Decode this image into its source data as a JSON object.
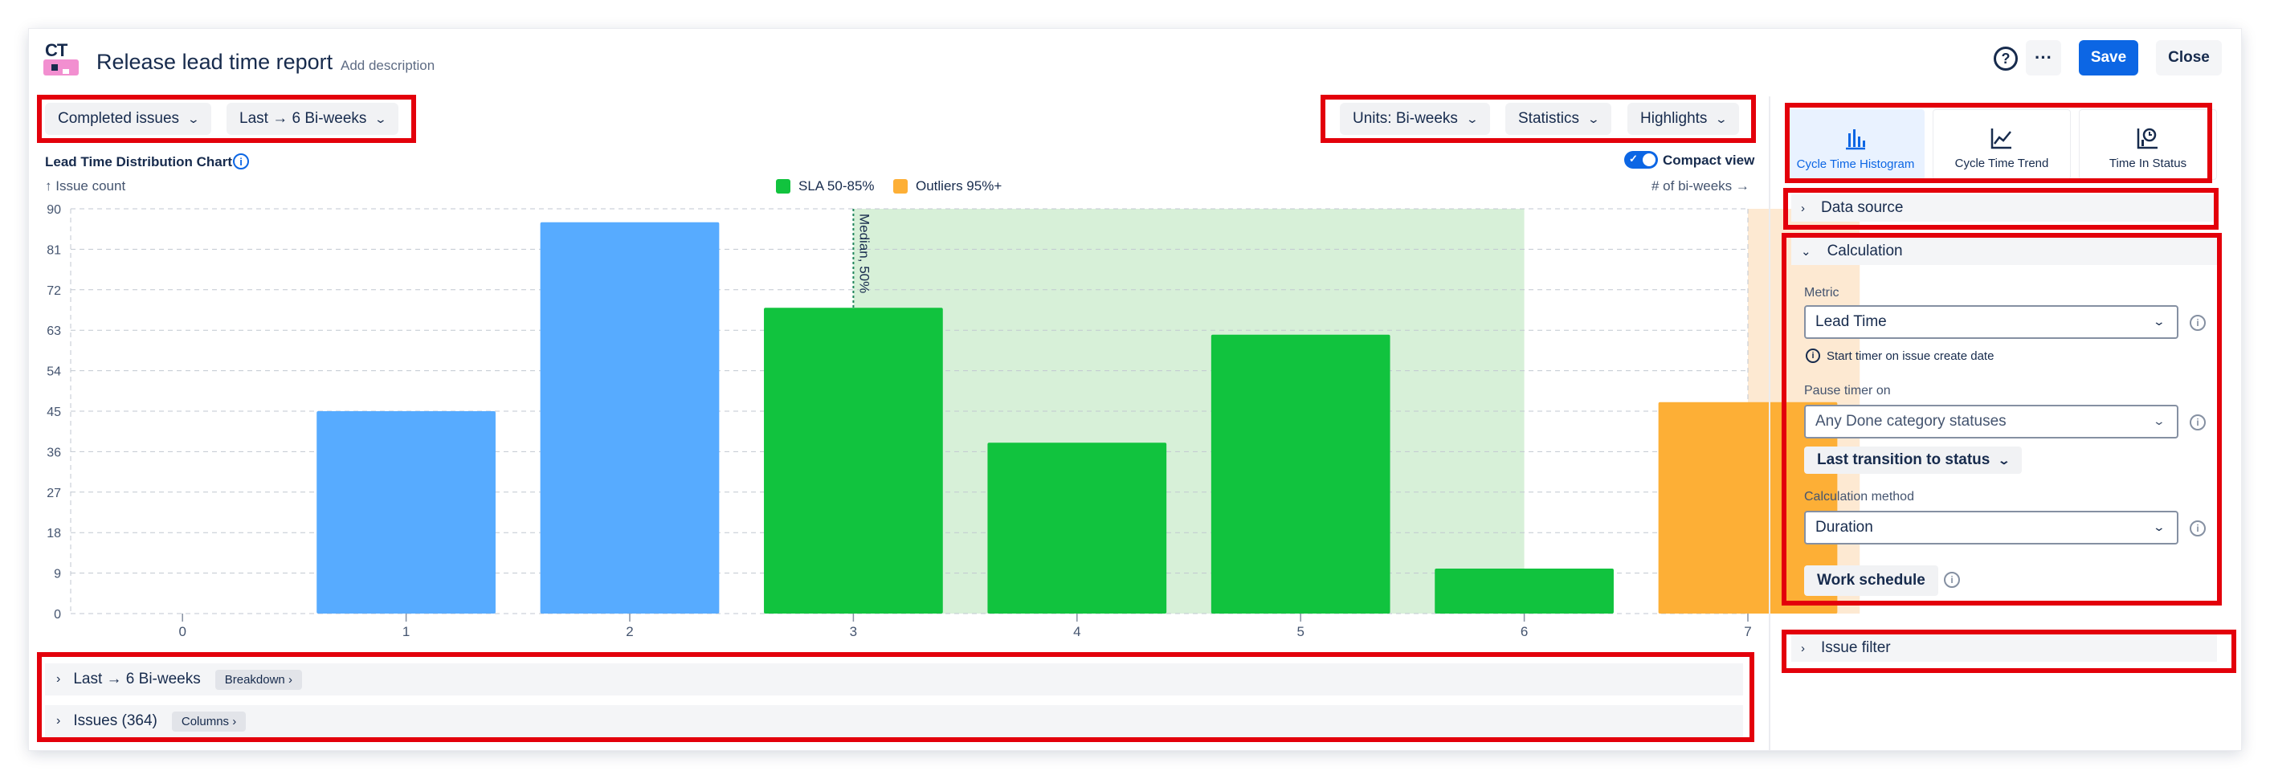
{
  "header": {
    "title": "Release lead time report",
    "add_description": "Add description",
    "help_label": "?",
    "more_label": "···",
    "save_label": "Save",
    "close_label": "Close",
    "logo_text": "CT"
  },
  "toolbar": {
    "issues_filter": "Completed issues",
    "period": "Last → 6 Bi-weeks",
    "units": "Units: Bi-weeks",
    "statistics": "Statistics",
    "highlights": "Highlights"
  },
  "chart_header": {
    "title": "Lead Time Distribution Chart",
    "compact_view": "Compact view",
    "y_hint": "↑ Issue count",
    "x_hint": "# of bi-weeks →"
  },
  "chart_data": {
    "type": "bar",
    "title": "Lead Time Distribution Chart",
    "xlabel": "# of bi-weeks",
    "ylabel": "Issue count",
    "categories": [
      "0",
      "1",
      "2",
      "3",
      "4",
      "5",
      "6",
      "7"
    ],
    "values": [
      0,
      45,
      87,
      68,
      38,
      62,
      10,
      47
    ],
    "bar_colors": [
      "#57abff",
      "#57abff",
      "#57abff",
      "#11c33e",
      "#11c33e",
      "#11c33e",
      "#11c33e",
      "#fdaf36"
    ],
    "ylim": [
      0,
      90
    ],
    "yticks": [
      0,
      9,
      18,
      27,
      36,
      45,
      54,
      63,
      72,
      81,
      90
    ],
    "grid": true,
    "legend": [
      {
        "name": "SLA 50-85%",
        "color": "#11c33e"
      },
      {
        "name": "Outliers 95%+",
        "color": "#fdaf36"
      }
    ],
    "bands": [
      {
        "name": "SLA 50-85%",
        "from": 3,
        "to": 6,
        "color": "#d7f0d8"
      },
      {
        "name": "Outliers 95%+",
        "from": 7,
        "to": 7.5,
        "color": "#fde9d2"
      }
    ],
    "median": {
      "label": "Median, 50%",
      "x": 3
    }
  },
  "accordion": {
    "period_label": "Last → 6 Bi-weeks",
    "breakdown": "Breakdown",
    "issues_label": "Issues (364)",
    "columns": "Columns"
  },
  "panel": {
    "tabs": [
      {
        "label": "Cycle Time Histogram"
      },
      {
        "label": "Cycle Time Trend"
      },
      {
        "label": "Time In Status"
      }
    ],
    "data_source": "Data source",
    "calculation": "Calculation",
    "metric_label": "Metric",
    "metric_value": "Lead Time",
    "metric_hint": "Start timer on issue create date",
    "pause_label": "Pause timer on",
    "pause_value": "Any Done category statuses",
    "transition_button": "Last transition to status",
    "method_label": "Calculation method",
    "method_value": "Duration",
    "work_schedule": "Work schedule",
    "issue_filter": "Issue filter"
  }
}
